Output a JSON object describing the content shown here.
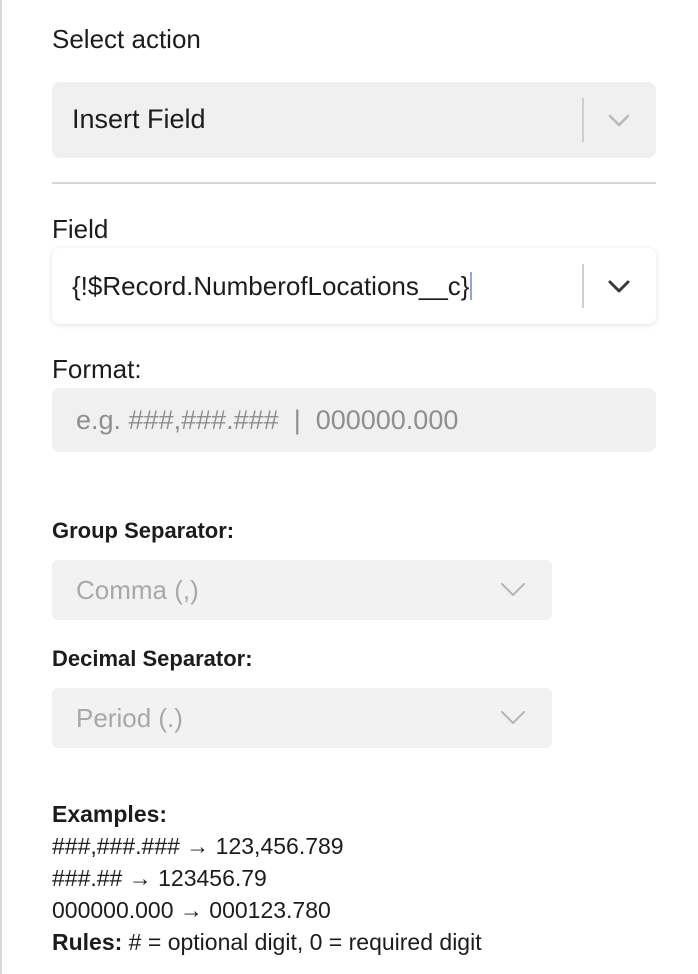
{
  "action": {
    "label": "Select action",
    "value": "Insert Field"
  },
  "field": {
    "label": "Field",
    "value": "{!$Record.NumberofLocations__c}"
  },
  "format": {
    "label": "Format:",
    "placeholder": "e.g. ###,###.###  |  000000.000",
    "value": ""
  },
  "group_separator": {
    "label": "Group Separator:",
    "value": "Comma (,)"
  },
  "decimal_separator": {
    "label": "Decimal Separator:",
    "value": "Period (.)"
  },
  "examples": {
    "heading": "Examples:",
    "lines": [
      "###,###.### → 123,456.789",
      "###.## → 123456.79",
      "000000.000 → 000123.780"
    ],
    "rules_label": "Rules:",
    "rules_text": " # = optional digit, 0 = required digit"
  },
  "icons": {
    "dropdown": "chevron-down-icon"
  },
  "colors": {
    "field_bg": "#f0f0f0",
    "disabled_text": "#a8a8a8",
    "caret": "#8fa6d6"
  }
}
